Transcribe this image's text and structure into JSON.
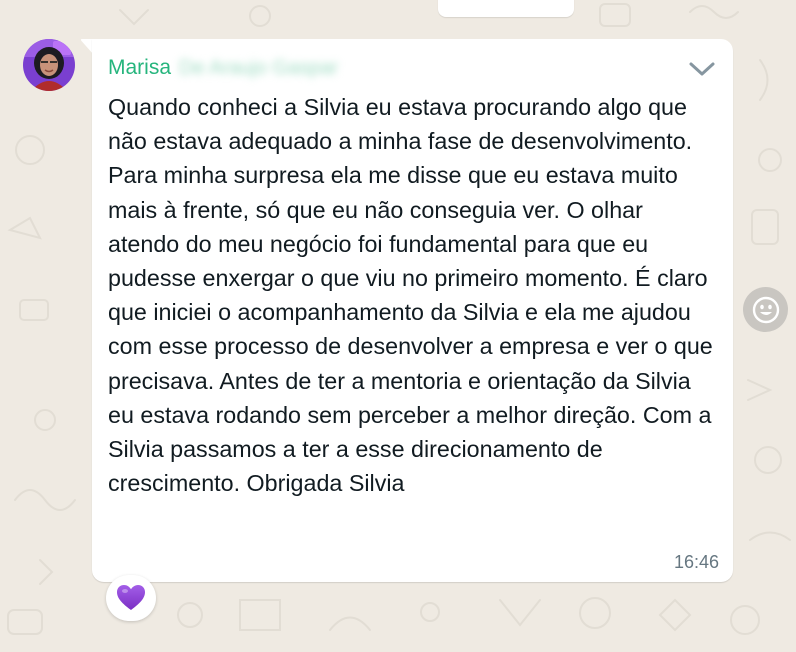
{
  "message": {
    "sender_name": "Marisa",
    "sender_surname_blurred": "De Araujo Gaspar",
    "text": "Quando conheci a Silvia eu estava procurando algo que não estava adequado a minha fase de desenvolvimento. Para minha surpresa ela me disse que eu estava muito mais à frente, só que eu não conseguia ver. O olhar atendo do meu negócio foi fundamental para que eu pudesse enxergar o que viu no primeiro momento. É claro que iniciei o acompanhamento da Silvia e ela me ajudou com esse processo de desenvolver a empresa e ver o que precisava. Antes de ter a mentoria e orientação da Silvia eu estava rodando sem perceber a melhor direção. Com a Silvia passamos a ter a esse direcionamento de crescimento. Obrigada Silvia",
    "time": "16:46",
    "reaction_icon": "purple-heart-icon",
    "menu_icon": "chevron-down-icon"
  },
  "colors": {
    "background": "#efeae2",
    "bubble": "#ffffff",
    "sender_name": "#26b57d",
    "text": "#111b21",
    "timestamp": "#667781",
    "reaction_heart": "#8e44d4"
  },
  "side_button": {
    "icon": "smiley-icon"
  }
}
